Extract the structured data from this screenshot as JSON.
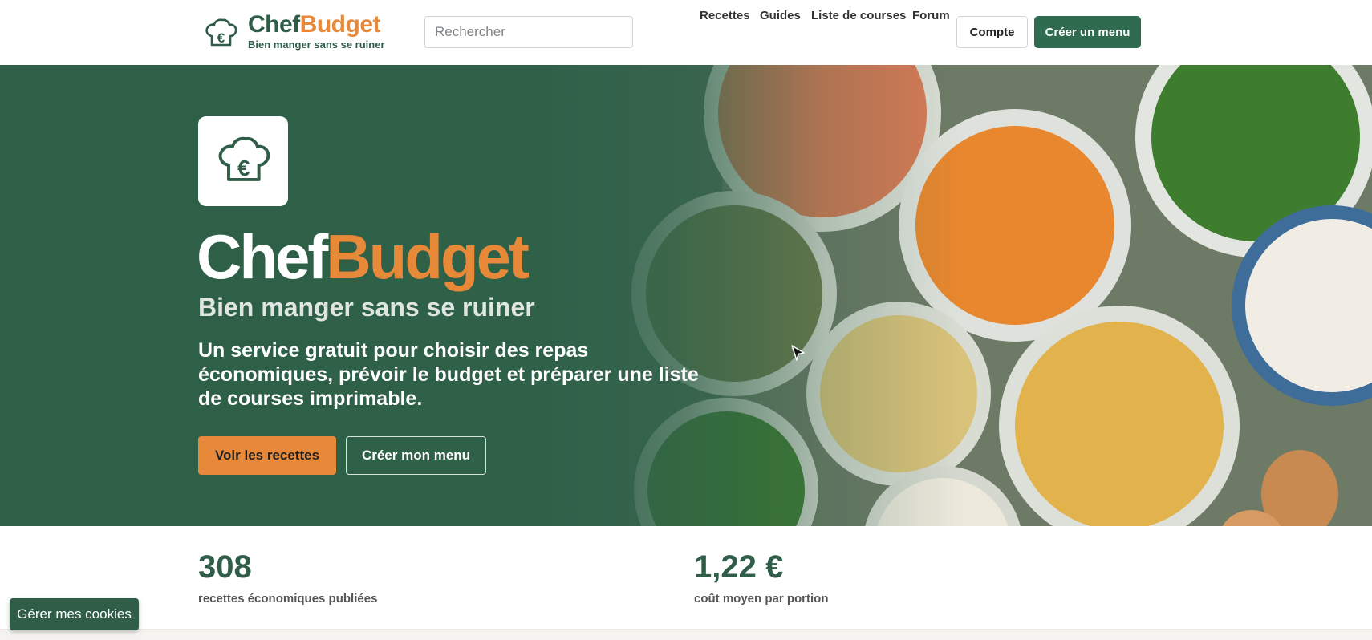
{
  "brand": {
    "name_part1": "Chef",
    "name_part2": "Budget",
    "tagline": "Bien manger sans se ruiner",
    "primary_color": "#2f5d47",
    "accent_color": "#e8893a"
  },
  "search": {
    "placeholder": "Rechercher"
  },
  "nav": {
    "items": [
      {
        "label": "Recettes"
      },
      {
        "label": "Guides"
      },
      {
        "label": "Liste de courses"
      },
      {
        "label": "Forum"
      }
    ],
    "account_label": "Compte",
    "create_menu_label": "Créer un menu"
  },
  "hero": {
    "logo_icon": "chef-hat-euro-icon",
    "title_part1": "Chef",
    "title_part2": "Budget",
    "subtitle": "Bien manger sans se ruiner",
    "description": "Un service gratuit pour choisir des repas économiques, prévoir le budget et préparer une liste de courses imprimable.",
    "primary_cta": "Voir les recettes",
    "secondary_cta": "Créer mon menu"
  },
  "stats": [
    {
      "value": "308",
      "label": "recettes économiques publiées"
    },
    {
      "value": "1,22 €",
      "label": "coût moyen par portion"
    }
  ],
  "cookie_button": "Gérer mes cookies"
}
